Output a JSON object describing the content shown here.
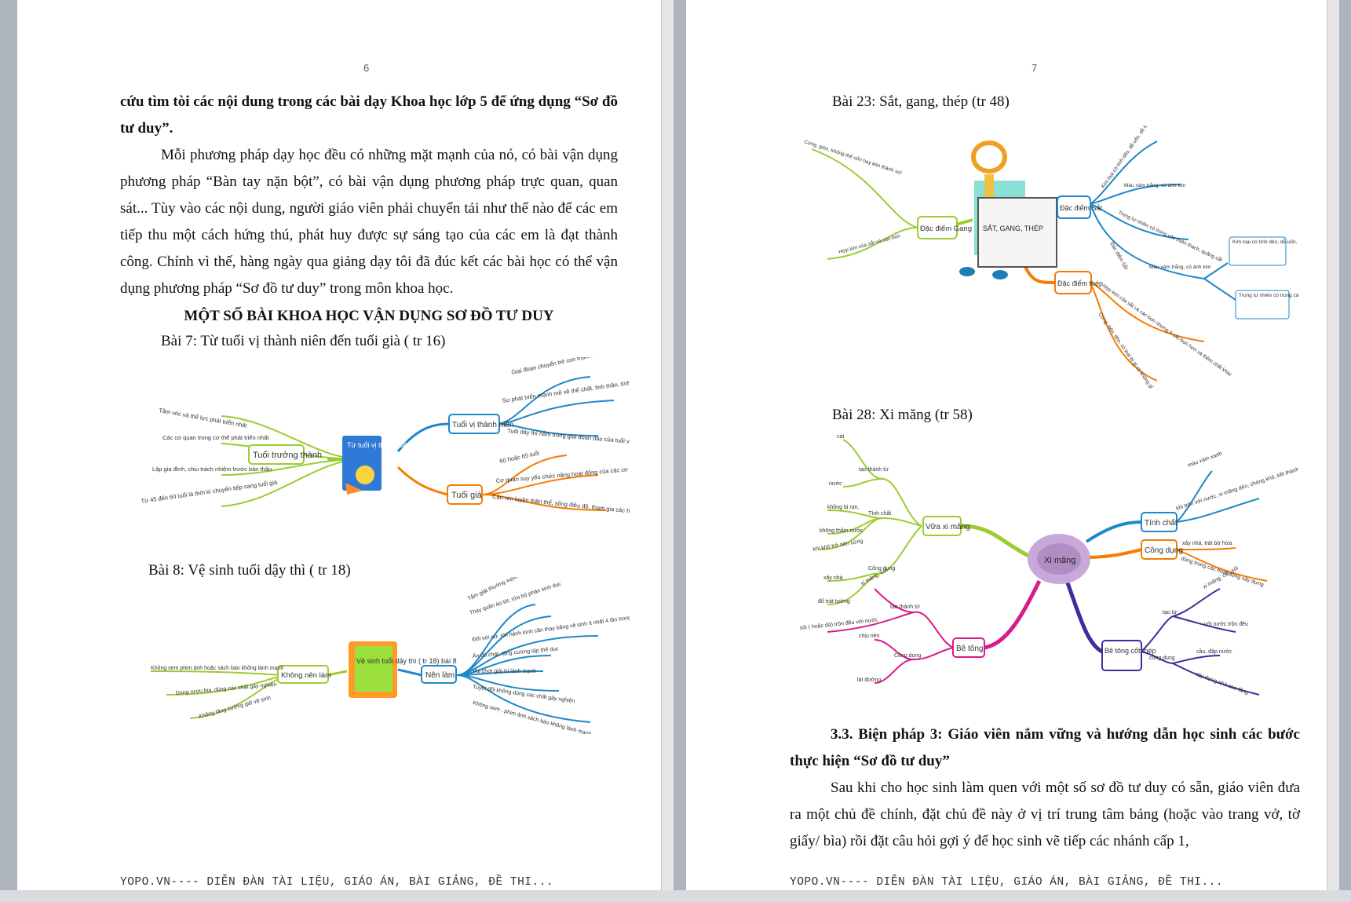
{
  "left_page": {
    "page_number": "6",
    "intro_bold": "cứu tìm tòi các nội dung trong các bài dạy Khoa học lớp 5 để ứng dụng “Sơ đồ tư duy”.",
    "paragraph": "Mỗi phương pháp dạy học đều có những mặt mạnh của nó, có bài vận dụng phương pháp “Bàn tay nặn bột”, có bài vận dụng phương pháp trực quan, quan sát... Tùy vào các nội dung, người giáo viên phải chuyển tải như thế nào để các em tiếp thu một cách hứng thú, phát huy được sự sáng tạo của các em là đạt thành công. Chính vì thế, hàng ngày qua giảng dạy tôi đã đúc kết các bài học có thể vận dụng phương pháp “Sơ đồ tư duy” trong môn khoa học.",
    "heading": "MỘT SỐ BÀI KHOA HỌC VẬN DỤNG SƠ ĐỒ TƯ DUY",
    "lesson7": "Bài 7: Từ tuổi vị thành niên đến tuổi già ( tr 16)",
    "lesson8": "Bài 8: Vệ sinh tuổi dậy thì ( tr 18)",
    "footer": "YOPO.VN---- DIỄN ĐÀN TÀI LIỆU, GIÁO ÁN, BÀI GIẢNG, ĐỀ THI..."
  },
  "right_page": {
    "page_number": "7",
    "lesson23": "Bài 23: Sắt, gang, thép (tr 48)",
    "lesson28": "Bài 28: Xi măng (tr 58)",
    "measure_heading": "3.3. Biện pháp 3: Giáo viên nắm vững và hướng dẫn học sinh các bước thực hiện “Sơ đồ tư duy”",
    "paragraph": "Sau khi cho học sinh làm quen với một số sơ đồ tư duy có sẵn, giáo viên đưa ra một chủ đề chính, đặt chủ đề này ở vị trí trung tâm bảng (hoặc vào trang vở, tờ giấy/ bìa) rồi đặt câu hỏi gợi ý để học sinh vẽ tiếp các nhánh cấp 1,",
    "footer": "YOPO.VN---- DIỄN ĐÀN TÀI LIỆU, GIÁO ÁN, BÀI GIẢNG, ĐỀ THI..."
  },
  "mindmap7": {
    "center": "Từ tuổi vị thành niên đến tuổi già",
    "b_vtn": "Tuổi vị thành niên",
    "b_gia": "Tuổi già",
    "b_tt": "Tuổi trưởng thành",
    "vtn1": "Giai đoạn chuyển trẻ con thành người lớn",
    "vtn2": "Sự phát triển mạnh mẽ về thể chất, tinh thần, tình cảm và các mối quan hệ",
    "vtn3": "Tuổi dậy thì nằm trong giai đoạn đầu của tuổi vị thành niên",
    "gia1": "60 hoặc 65 tuổi",
    "gia2": "Cơ quan suy yếu chức năng hoạt động của các cơ quan giảm dần",
    "gia3": "Cần rèn luyện thân thể, sống điều độ, tham gia các hoạt động xã hội",
    "tt1": "Tầm vóc và thể lực phát triển nhất",
    "tt2": "Các cơ quan trong cơ thể phát triển nhất",
    "tt3": "Lập gia đình, chịu trách nhiệm trước bản thân",
    "tt4": "Từ 45 đến 60 tuổi là thời kì chuyển tiếp sang tuổi già"
  },
  "mindmap8": {
    "center": "Vệ sinh tuổi dậy thì ( tr 18) bài 8",
    "b_nen": "Nên làm",
    "b_khong": "Không nên làm",
    "n1": "Tắm giặt thường xuyên",
    "n2": "Thay quần áo lót, rửa bộ phận sinh dục",
    "n3": "Đối với nữ, khi hành kinh cần thay băng vệ sinh ít nhất 4 lần trong ngày",
    "n4": "Ăn đủ chất, tăng cường tập thể dục",
    "n5": "Vui chơi giải trí lành mạnh",
    "n6": "Tuyệt đối không dùng các chất gây nghiện",
    "n7": "Không xem , phim ảnh sách báo không lành mạnh.",
    "k1": "Không xem phim ảnh hoặc sách báo không lành mạnh",
    "k2": "Dùng rượu bia, dùng các chất gây nghiện",
    "k3": "Không tăng cường giữ vệ sinh"
  },
  "mindmap23": {
    "center": "SẮT, GANG, THÉP",
    "b_gang": "Đặc điểm Gang",
    "b_sat": "Đặc điểm Sắt",
    "b_thep": "Đặc điểm thép",
    "g1": "Cứng, giòn, không thể uốn hay kéo thành sợi",
    "g2": "Hợp kim của sắt và các-bon",
    "s1": "Kim loại có tính dẻo, dễ uốn, dễ kéo thành sợi",
    "s2": "Màu xám trắng, có ánh kim",
    "s3": "Trong tự nhiên có trong các thiên thạch, quặng sắt",
    "s4": "Đặc điểm Sắt",
    "s5": "Màu xám trắng, có ánh kim",
    "s6": "Kim loại có tính dẻo, dễ uốn, dễ kéo thành sợi",
    "s7": "Trong tự nhiên có trong các thiên thạch, quặng sắt",
    "t1": "Hợp kim của sắt và các-bon nhưng ít các-bon hơn và thêm chất khác",
    "t2": "Cứng, bền, dẻo, có loại bị gỉ và không gỉ"
  },
  "mindmap28": {
    "center": "Xi măng",
    "b_vua": "Vữa xi măng",
    "b_betong": "Bê tông",
    "b_tinhchat": "Tính chất",
    "b_congdung": "Công dụng",
    "b_btct": "Bê tông cốt thép",
    "v1": "cát",
    "v2": "tạo thành từ",
    "v3": "nước",
    "v4": "không bị rạn,",
    "v5": "Tính chất",
    "v6": "không thấm nước",
    "v7": "khi khô trở nên cứng",
    "v8": "Công dụng",
    "v9": "xây nhà",
    "v10": "đổ trát tường",
    "bt1": "xi măng, cát",
    "bt2": "tạo thành từ",
    "bt3": "sỏi ( hoặc đá) trộn đều với nước",
    "bt4": "chịu nén",
    "bt5": "Công dụng",
    "bt6": "lát đường",
    "tc1": "màu xám xanh",
    "tc2": "khi trộn với nước, xi măng dẻo, chóng khô, kết thành",
    "cd1": "xây nhà, trát bờ hừa",
    "cd2": "dùng trong các hoạt động xây dựng",
    "ct1": "tạo từ",
    "ct2": "xi măng, cát, sỏi",
    "ct3": "với nước trộn đều",
    "ct4": "công dụng",
    "ct5": "cầu, đập nước",
    "ct6": "xây dựng nhà cao tầng"
  }
}
